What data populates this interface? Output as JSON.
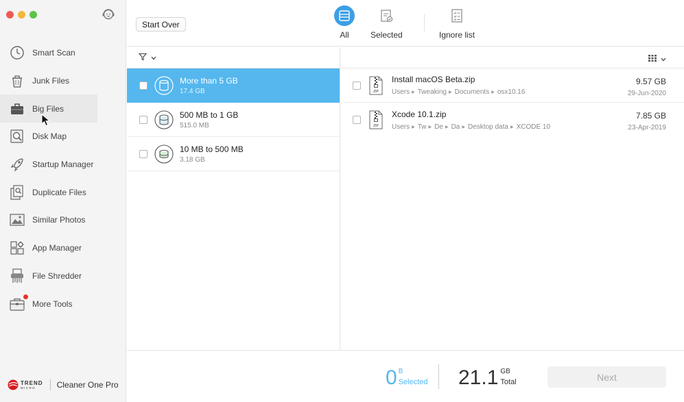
{
  "sidebar": {
    "items": [
      {
        "label": "Smart Scan",
        "icon": "clock-icon"
      },
      {
        "label": "Junk Files",
        "icon": "trash-can-icon"
      },
      {
        "label": "Big Files",
        "icon": "suitcase-icon"
      },
      {
        "label": "Disk Map",
        "icon": "magnifier-icon"
      },
      {
        "label": "Startup Manager",
        "icon": "rocket-icon"
      },
      {
        "label": "Duplicate Files",
        "icon": "duplicate-icon"
      },
      {
        "label": "Similar Photos",
        "icon": "photo-icon"
      },
      {
        "label": "App Manager",
        "icon": "app-grid-icon"
      },
      {
        "label": "File Shredder",
        "icon": "shredder-icon"
      },
      {
        "label": "More Tools",
        "icon": "toolbox-icon"
      }
    ],
    "active_index": 2,
    "brand": {
      "company": "TREND",
      "company_sub": "MICRO",
      "product": "Cleaner One Pro"
    }
  },
  "toolbar": {
    "start_over": "Start Over",
    "tabs": [
      {
        "label": "All",
        "icon": "drive-icon",
        "active": true
      },
      {
        "label": "Selected",
        "icon": "selected-doc-icon",
        "active": false
      },
      {
        "label": "Ignore list",
        "icon": "checklist-icon",
        "active": false
      }
    ]
  },
  "categories": [
    {
      "name": "More than 5 GB",
      "size": "17.4 GB",
      "selected": true
    },
    {
      "name": "500 MB to 1 GB",
      "size": "515.0 MB",
      "selected": false
    },
    {
      "name": "10 MB to 500 MB",
      "size": "3.18 GB",
      "selected": false
    }
  ],
  "files": [
    {
      "name": "Install macOS Beta.zip",
      "path": [
        "Users",
        "Tweaking",
        "Documents",
        "osx10.16"
      ],
      "size": "9.57 GB",
      "date": "29-Jun-2020"
    },
    {
      "name": "Xcode 10.1.zip",
      "path": [
        "Users",
        "Tw",
        "De",
        "Da",
        "Desktop data",
        "XCODE 10"
      ],
      "size": "7.85 GB",
      "date": "23-Apr-2019"
    }
  ],
  "footer": {
    "selected_value": "0",
    "selected_unit": "B",
    "selected_caption": "Selected",
    "total_value": "21.1",
    "total_unit": "GB",
    "total_caption": "Total",
    "next_label": "Next"
  },
  "colors": {
    "accent": "#55b7ee",
    "tab_active": "#3d9fe5",
    "notification_dot": "#e8322b",
    "brand_red": "#d71920"
  }
}
